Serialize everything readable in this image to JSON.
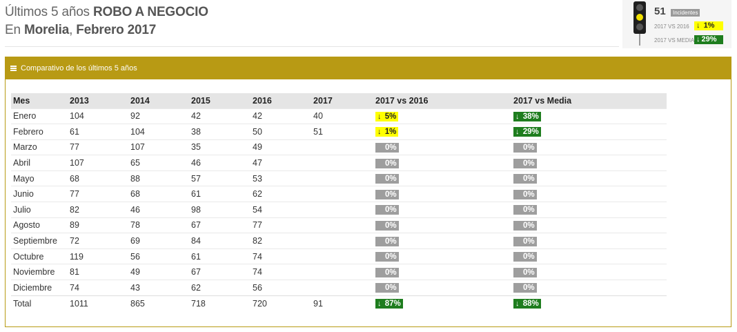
{
  "header": {
    "line1_prefix": "Últimos 5 años",
    "line1_bold": "ROBO A NEGOCIO",
    "line2_prefix": "En",
    "line2_city": "Morelia",
    "line2_sep": ",",
    "line2_period": "Febrero 2017"
  },
  "widget": {
    "count": "51",
    "count_label": "Incidentes",
    "vs2016_label": "2017 VS 2016",
    "vs2016_value": "1%",
    "vsmedia_label": "2017 VS MEDIA",
    "vsmedia_value": "29%",
    "arrow": "↓",
    "colors": {
      "yellow": "#ffff00",
      "green": "#1e7d1e",
      "light": "#f1e000"
    }
  },
  "panel": {
    "title": "Comparativo de los últimos 5 años",
    "accent": "#b89a14"
  },
  "table": {
    "headers": [
      "Mes",
      "2013",
      "2014",
      "2015",
      "2016",
      "2017",
      "2017 vs 2016",
      "2017 vs Media"
    ],
    "rows": [
      {
        "mes": "Enero",
        "y2013": "104",
        "y2014": "92",
        "y2015": "42",
        "y2016": "42",
        "y2017": "40",
        "vs2016": {
          "value": "5%",
          "style": "yellow",
          "arrow": "↓"
        },
        "vsmedia": {
          "value": "38%",
          "style": "green",
          "arrow": "↓"
        }
      },
      {
        "mes": "Febrero",
        "y2013": "61",
        "y2014": "104",
        "y2015": "38",
        "y2016": "50",
        "y2017": "51",
        "vs2016": {
          "value": "1%",
          "style": "yellow",
          "arrow": "↓"
        },
        "vsmedia": {
          "value": "29%",
          "style": "green",
          "arrow": "↓"
        }
      },
      {
        "mes": "Marzo",
        "y2013": "77",
        "y2014": "107",
        "y2015": "35",
        "y2016": "49",
        "y2017": "",
        "vs2016": {
          "value": "0%",
          "style": "gray",
          "arrow": ""
        },
        "vsmedia": {
          "value": "0%",
          "style": "gray",
          "arrow": ""
        }
      },
      {
        "mes": "Abril",
        "y2013": "107",
        "y2014": "65",
        "y2015": "46",
        "y2016": "47",
        "y2017": "",
        "vs2016": {
          "value": "0%",
          "style": "gray",
          "arrow": ""
        },
        "vsmedia": {
          "value": "0%",
          "style": "gray",
          "arrow": ""
        }
      },
      {
        "mes": "Mayo",
        "y2013": "68",
        "y2014": "88",
        "y2015": "57",
        "y2016": "53",
        "y2017": "",
        "vs2016": {
          "value": "0%",
          "style": "gray",
          "arrow": ""
        },
        "vsmedia": {
          "value": "0%",
          "style": "gray",
          "arrow": ""
        }
      },
      {
        "mes": "Junio",
        "y2013": "77",
        "y2014": "68",
        "y2015": "61",
        "y2016": "62",
        "y2017": "",
        "vs2016": {
          "value": "0%",
          "style": "gray",
          "arrow": ""
        },
        "vsmedia": {
          "value": "0%",
          "style": "gray",
          "arrow": ""
        }
      },
      {
        "mes": "Julio",
        "y2013": "82",
        "y2014": "46",
        "y2015": "98",
        "y2016": "54",
        "y2017": "",
        "vs2016": {
          "value": "0%",
          "style": "gray",
          "arrow": ""
        },
        "vsmedia": {
          "value": "0%",
          "style": "gray",
          "arrow": ""
        }
      },
      {
        "mes": "Agosto",
        "y2013": "89",
        "y2014": "78",
        "y2015": "67",
        "y2016": "77",
        "y2017": "",
        "vs2016": {
          "value": "0%",
          "style": "gray",
          "arrow": ""
        },
        "vsmedia": {
          "value": "0%",
          "style": "gray",
          "arrow": ""
        }
      },
      {
        "mes": "Septiembre",
        "y2013": "72",
        "y2014": "69",
        "y2015": "84",
        "y2016": "82",
        "y2017": "",
        "vs2016": {
          "value": "0%",
          "style": "gray",
          "arrow": ""
        },
        "vsmedia": {
          "value": "0%",
          "style": "gray",
          "arrow": ""
        }
      },
      {
        "mes": "Octubre",
        "y2013": "119",
        "y2014": "56",
        "y2015": "61",
        "y2016": "74",
        "y2017": "",
        "vs2016": {
          "value": "0%",
          "style": "gray",
          "arrow": ""
        },
        "vsmedia": {
          "value": "0%",
          "style": "gray",
          "arrow": ""
        }
      },
      {
        "mes": "Noviembre",
        "y2013": "81",
        "y2014": "49",
        "y2015": "67",
        "y2016": "74",
        "y2017": "",
        "vs2016": {
          "value": "0%",
          "style": "gray",
          "arrow": ""
        },
        "vsmedia": {
          "value": "0%",
          "style": "gray",
          "arrow": ""
        }
      },
      {
        "mes": "Diciembre",
        "y2013": "74",
        "y2014": "43",
        "y2015": "62",
        "y2016": "56",
        "y2017": "",
        "vs2016": {
          "value": "0%",
          "style": "gray",
          "arrow": ""
        },
        "vsmedia": {
          "value": "0%",
          "style": "gray",
          "arrow": ""
        }
      }
    ],
    "total": {
      "mes": "Total",
      "y2013": "1011",
      "y2014": "865",
      "y2015": "718",
      "y2016": "720",
      "y2017": "91",
      "vs2016": {
        "value": "87%",
        "style": "green",
        "arrow": "↓"
      },
      "vsmedia": {
        "value": "88%",
        "style": "green",
        "arrow": "↓"
      }
    }
  }
}
